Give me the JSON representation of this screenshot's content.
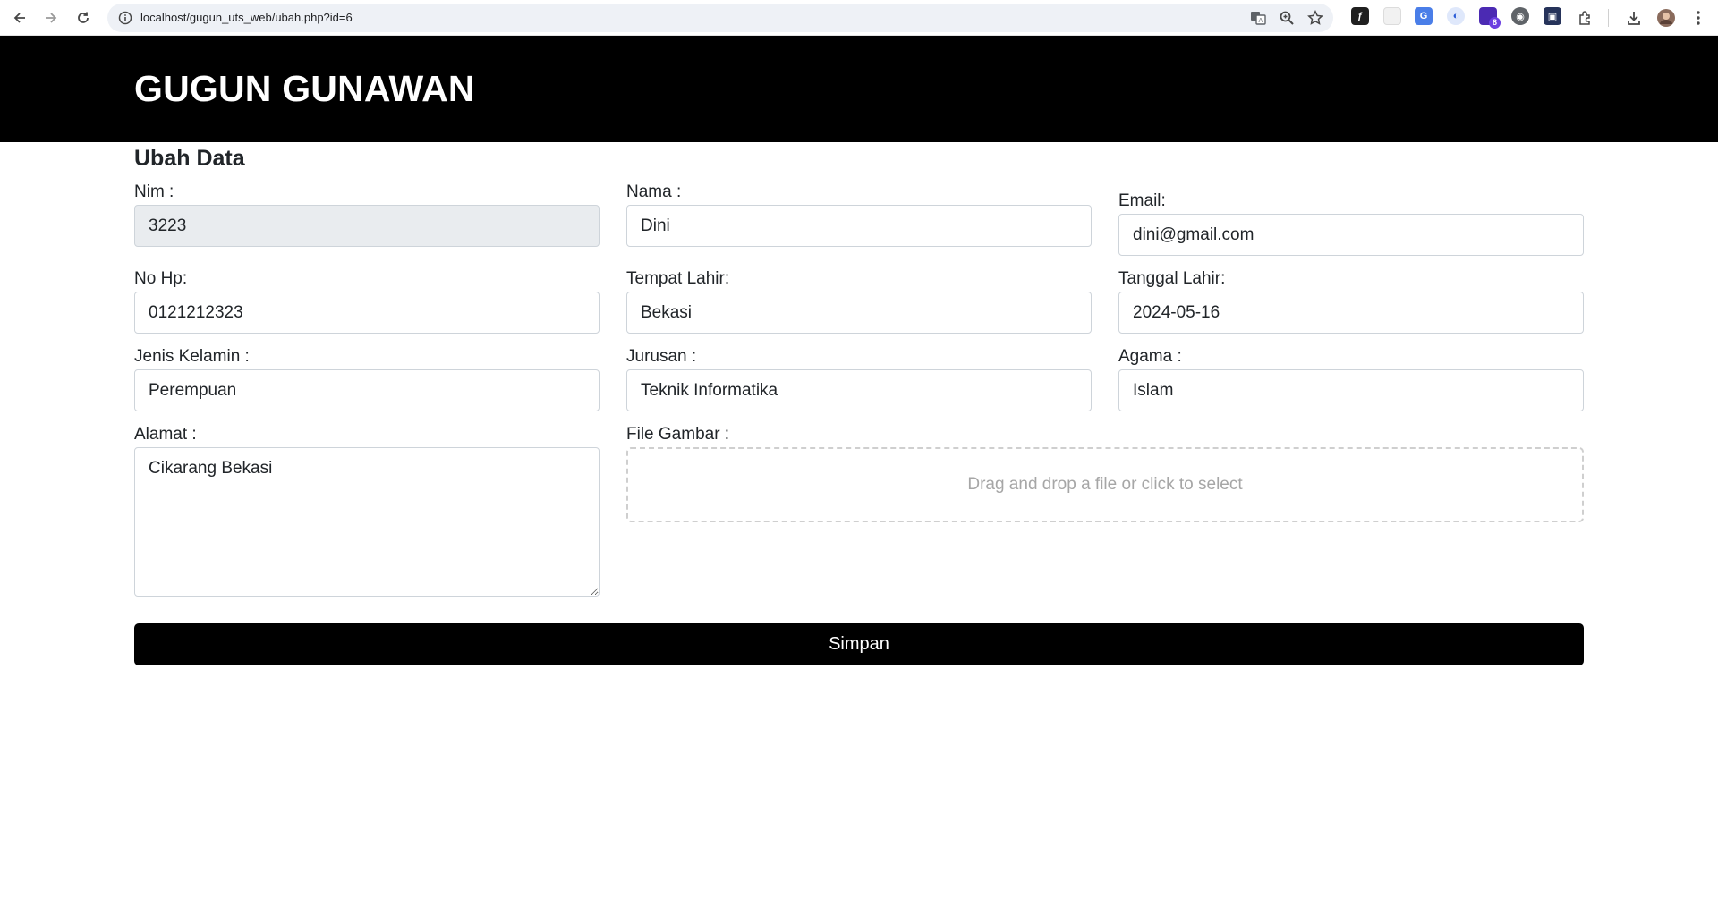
{
  "browser": {
    "url": "localhost/gugun_uts_web/ubah.php?id=6",
    "extension_badge": "8"
  },
  "header": {
    "title": "GUGUN GUNAWAN"
  },
  "form": {
    "heading": "Ubah Data",
    "nim": {
      "label": "Nim :",
      "value": "3223"
    },
    "nama": {
      "label": "Nama :",
      "value": "Dini"
    },
    "email": {
      "label": "Email:",
      "value": "dini@gmail.com"
    },
    "no_hp": {
      "label": "No Hp:",
      "value": "0121212323"
    },
    "tempat_lahir": {
      "label": "Tempat Lahir:",
      "value": "Bekasi"
    },
    "tanggal_lahir": {
      "label": "Tanggal Lahir:",
      "value": "2024-05-16"
    },
    "jenis_kelamin": {
      "label": "Jenis Kelamin :",
      "value": "Perempuan"
    },
    "jurusan": {
      "label": "Jurusan :",
      "value": "Teknik Informatika"
    },
    "agama": {
      "label": "Agama :",
      "value": "Islam"
    },
    "alamat": {
      "label": "Alamat :",
      "value": "Cikarang Bekasi"
    },
    "file_gambar": {
      "label": "File Gambar :",
      "placeholder": "Drag and drop a file or click to select"
    },
    "submit_label": "Simpan"
  }
}
